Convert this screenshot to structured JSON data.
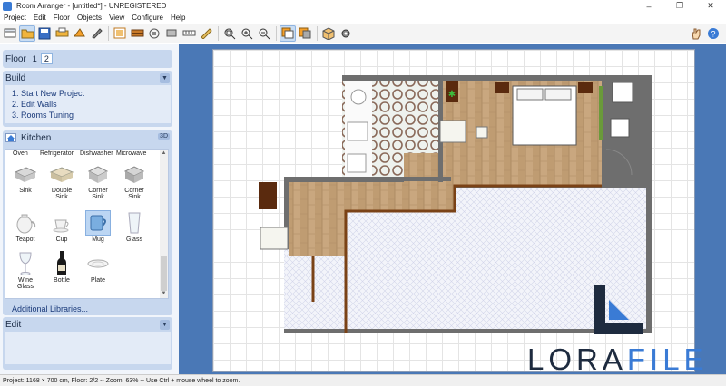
{
  "window": {
    "title": "Room Arranger - [untitled*] - UNREGISTERED"
  },
  "menu": [
    "Project",
    "Edit",
    "Floor",
    "Objects",
    "View",
    "Configure",
    "Help"
  ],
  "toolbar": {
    "buttons": [
      "new-icon",
      "open-icon",
      "save-icon",
      "print-icon",
      "undo-icon",
      "paint-icon",
      "zoom-fit-icon",
      "wall-icon",
      "measure-icon",
      "zoom-in-icon",
      "zoom-out-icon",
      "view-2d-icon",
      "view-3d-icon",
      "settings-icon"
    ],
    "active": "view-2d-icon"
  },
  "floor": {
    "label": "Floor",
    "tabs": [
      "1",
      "2"
    ],
    "selected": "2"
  },
  "build": {
    "label": "Build",
    "steps": [
      "1. Start New Project",
      "2. Edit Walls",
      "3. Rooms Tuning"
    ]
  },
  "kitchen": {
    "label": "Kitchen",
    "badge": "3D",
    "top_row": [
      "Oven",
      "Refrigerator",
      "Dishwasher",
      "Microwave"
    ],
    "items": [
      {
        "label": "Sink",
        "icon": "sink-icon"
      },
      {
        "label": "Double\nSink",
        "icon": "double-sink-icon"
      },
      {
        "label": "Corner\nSink",
        "icon": "corner-sink-icon"
      },
      {
        "label": "Corner\nSink",
        "icon": "corner-sink-icon"
      },
      {
        "label": "Teapot",
        "icon": "teapot-icon"
      },
      {
        "label": "Cup",
        "icon": "cup-icon"
      },
      {
        "label": "Mug",
        "icon": "mug-icon",
        "selected": true
      },
      {
        "label": "Glass",
        "icon": "glass-icon"
      },
      {
        "label": "Wine\nGlass",
        "icon": "wine-glass-icon"
      },
      {
        "label": "Bottle",
        "icon": "bottle-icon"
      },
      {
        "label": "Plate",
        "icon": "plate-icon"
      }
    ],
    "additional_libraries": "Additional Libraries..."
  },
  "edit": {
    "label": "Edit"
  },
  "status": "Project: 1168 × 700 cm, Floor: 2/2 -- Zoom: 63% -- Use Ctrl + mouse wheel to zoom.",
  "watermark": {
    "part1": "LORA",
    "part2": "FILE"
  },
  "colors": {
    "accent": "#3a7bd5",
    "panel": "#c7d7ee",
    "canvas": "#4a78b6",
    "wall": "#6e6e6e",
    "wood": "#c9a77f",
    "tile": "#9a7a6a"
  }
}
